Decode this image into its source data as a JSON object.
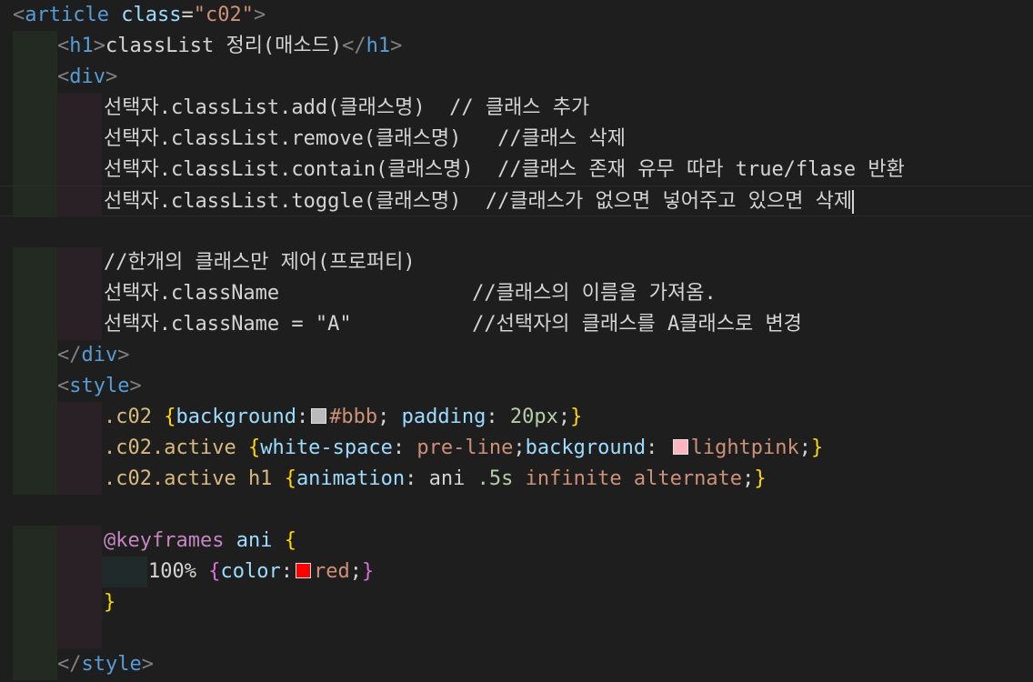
{
  "lines": {
    "l0": {
      "lt": "<",
      "tag": "article",
      "attr": "class",
      "eq": "=",
      "str": "\"c02\"",
      "gt": ">"
    },
    "l1": {
      "lt": "<",
      "tag": "h1",
      "gt": ">",
      "text": "classList 정리(매소드)",
      "close_lt": "</",
      "close_tag": "h1",
      "close_gt": ">"
    },
    "l2": {
      "lt": "<",
      "tag": "div",
      "gt": ">"
    },
    "l3": {
      "text": "선택자.classList.add(클래스명)  // 클래스 추가"
    },
    "l4": {
      "text": "선택자.classList.remove(클래스명)   //클래스 삭제"
    },
    "l5": {
      "text": "선택자.classList.contain(클래스명)  //클래스 존재 유무 따라 true/flase 반환"
    },
    "l6": {
      "text": "선택자.classList.toggle(클래스명)  //클래스가 없으면 넣어주고 있으면 삭제"
    },
    "l8": {
      "text": "//한개의 클래스만 제어(프로퍼티)"
    },
    "l9": {
      "text": "선택자.className                //클래스의 이름을 가져옴."
    },
    "l10": {
      "text": "선택자.className = \"A\"          //선택자의 클래스를 A클래스로 변경"
    },
    "l11": {
      "lt": "</",
      "tag": "div",
      "gt": ">"
    },
    "l12": {
      "lt": "<",
      "tag": "style",
      "gt": ">"
    },
    "l13": {
      "sel": ".c02 ",
      "ob": "{",
      "prop1": "background",
      "colon1": ":",
      "color1": "#bbb",
      "semi1": "; ",
      "prop2": "padding",
      "colon2": ": ",
      "num2": "20px",
      "semi2": ";",
      "cb": "}"
    },
    "l14": {
      "sel": ".c02.active ",
      "ob": "{",
      "prop1": "white-space",
      "colon1": ": ",
      "val1": "pre-line",
      "semi1": ";",
      "prop2": "background",
      "colon2": ": ",
      "color2": "lightpink",
      "semi2": ";",
      "cb": "}"
    },
    "l15": {
      "sel": ".c02.active h1 ",
      "ob": "{",
      "prop1": "animation",
      "colon1": ": ",
      "name": "ani ",
      "num": ".5s",
      "val": " infinite alternate",
      "semi": ";",
      "cb": "}"
    },
    "l17": {
      "at": "@keyframes",
      "name": " ani ",
      "ob": "{"
    },
    "l18": {
      "pct": "100% ",
      "ob": "{",
      "prop": "color",
      "colon": ":",
      "color": "red",
      "semi": ";",
      "cb": "}"
    },
    "l19": {
      "cb": "}"
    },
    "l21": {
      "lt": "</",
      "tag": "style",
      "gt": ">"
    }
  },
  "colors": {
    "swatch_bbb": "#bbbbbb",
    "swatch_lightpink": "#ffb6c1",
    "swatch_red": "#ff0000"
  }
}
